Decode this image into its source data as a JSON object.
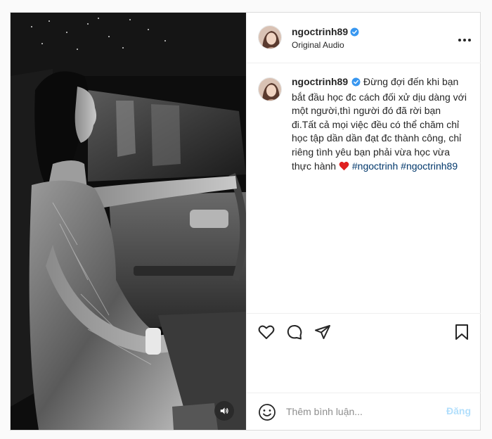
{
  "post": {
    "author": {
      "username": "ngoctrinh89",
      "verified": true,
      "subtitle": "Original Audio"
    },
    "caption": {
      "username": "ngoctrinh89",
      "text": "Đừng đợi đến khi bạn bắt đầu học đc cách đối xử dịu dàng với một người,thì người đó đã rời bạn đi.Tất cả mọi việc đều có thể chăm chỉ học tập dần dần đạt đc thành công, chỉ riêng tình yêu bạn phải vừa học vừa thực hành",
      "emoji": "red-heart",
      "hashtags": [
        "#ngoctrinh",
        "#ngoctrinh89"
      ]
    },
    "media": {
      "type": "video",
      "description_icon": "volume-icon",
      "grayscale": true
    },
    "actions": [
      "like-icon",
      "comment-icon",
      "share-icon",
      "save-icon"
    ],
    "comment_box": {
      "placeholder": "Thêm bình luận...",
      "post_label": "Đăng"
    }
  },
  "colors": {
    "verified_badge": "#3897f0",
    "hashtag": "#00376b",
    "post_button_disabled": "#b2dffc",
    "heart": "#e02020"
  }
}
